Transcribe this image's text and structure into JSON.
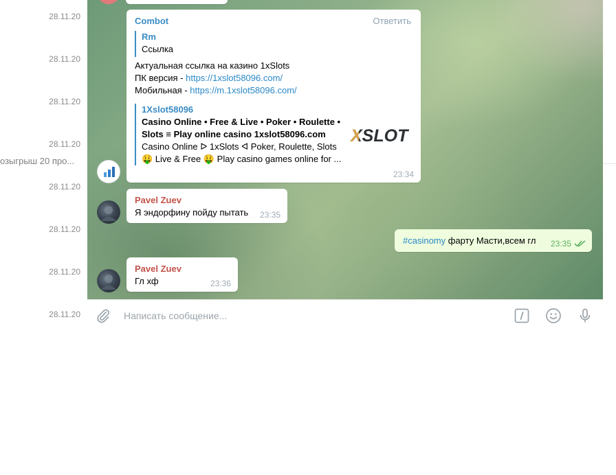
{
  "dialog_list": {
    "dates": [
      "28.11.20",
      "28.11.20",
      "28.11.20",
      "28.11.20",
      "28.11.20",
      "28.11.20",
      "28.11.20",
      "28.11.20"
    ],
    "preview_snippet": "озыгрыш 20 про..."
  },
  "messages": {
    "combot": {
      "sender": "Combot",
      "reply_label": "Ответить",
      "quote_name": "Rm",
      "quote_text": "Ссылка",
      "line1": "Актуальная ссылка на казино 1xSlots",
      "pc_label": "ПК версия - ",
      "pc_link": "https://1xslot58096.com/",
      "mobile_label": "Мобильная - ",
      "mobile_link": "https://m.1xslot58096.com/",
      "preview_site": "1Xslot58096",
      "preview_title_1": "Casino Online • Free & Live • Poker • Roulette •",
      "preview_title_2": "Slots ≡ Play online casino 1xslot58096.com",
      "preview_desc_1": "Casino Online ᐅ 1xSlots ᐊ Poker, Roulette, Slots",
      "preview_desc_2": "🤑 Live & Free 🤑 Play casino games online for ...",
      "preview_logo_text": "XSLOT",
      "time": "23:34"
    },
    "pavel1": {
      "sender": "Pavel Zuev",
      "text": "Я эндорфину пойду пытать",
      "time": "23:35"
    },
    "outgoing": {
      "hashtag": "#casinomy",
      "text": " фарту Масти,всем гл",
      "time": "23:35"
    },
    "pavel2": {
      "sender": "Pavel Zuev",
      "text": "Гл хф",
      "time": "23:36"
    }
  },
  "composer": {
    "placeholder": "Написать сообщение..."
  },
  "colors": {
    "link": "#2a88c7",
    "sender_blue": "#3a8cc5",
    "sender_red": "#c2524a",
    "outgoing_bubble": "#effdde",
    "read_ticks": "#5eb162"
  }
}
